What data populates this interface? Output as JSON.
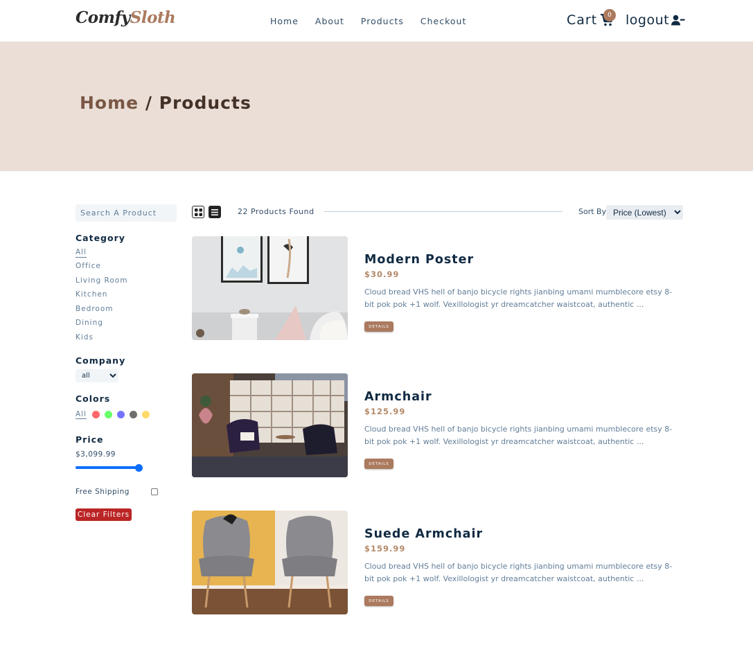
{
  "nav": {
    "logo_part1": "Comfy",
    "logo_part2": "Sloth",
    "links": [
      "Home",
      "About",
      "Products",
      "Checkout"
    ],
    "cart_label": "Cart",
    "cart_count": "0",
    "logout_label": "logout"
  },
  "hero": {
    "home": "Home",
    "sep": " / ",
    "current": "Products"
  },
  "filters": {
    "search_placeholder": "Search A Product",
    "category_title": "Category",
    "categories": [
      "All",
      "Office",
      "Living Room",
      "Kitchen",
      "Bedroom",
      "Dining",
      "Kids"
    ],
    "company_title": "Company",
    "company_value": "all",
    "colors_title": "Colors",
    "colors_all": "All",
    "colors": [
      "#ff0000",
      "#00ff00",
      "#0000ff",
      "#000000",
      "#ffb900"
    ],
    "price_title": "Price",
    "price_value": "$3,099.99",
    "price_fraction": 1.0,
    "shipping_label": "Free Shipping",
    "shipping_checked": false,
    "clear_label": "Clear Filters"
  },
  "toolbar": {
    "found": "22 Products Found",
    "sort_label": "Sort By",
    "sort_value": "Price (Lowest)"
  },
  "products": [
    {
      "name": "Modern Poster",
      "price": "$30.99",
      "desc": "Cloud bread VHS hell of banjo bicycle rights jianbing umami mumblecore etsy 8-bit pok pok +1 wolf. Vexillologist yr dreamcatcher waistcoat, authentic ...",
      "button": "DETAILS"
    },
    {
      "name": "Armchair",
      "price": "$125.99",
      "desc": "Cloud bread VHS hell of banjo bicycle rights jianbing umami mumblecore etsy 8-bit pok pok +1 wolf. Vexillologist yr dreamcatcher waistcoat, authentic ...",
      "button": "DETAILS"
    },
    {
      "name": "Suede Armchair",
      "price": "$159.99",
      "desc": "Cloud bread VHS hell of banjo bicycle rights jianbing umami mumblecore etsy 8-bit pok pok +1 wolf. Vexillologist yr dreamcatcher waistcoat, authentic ...",
      "button": "DETAILS"
    }
  ]
}
